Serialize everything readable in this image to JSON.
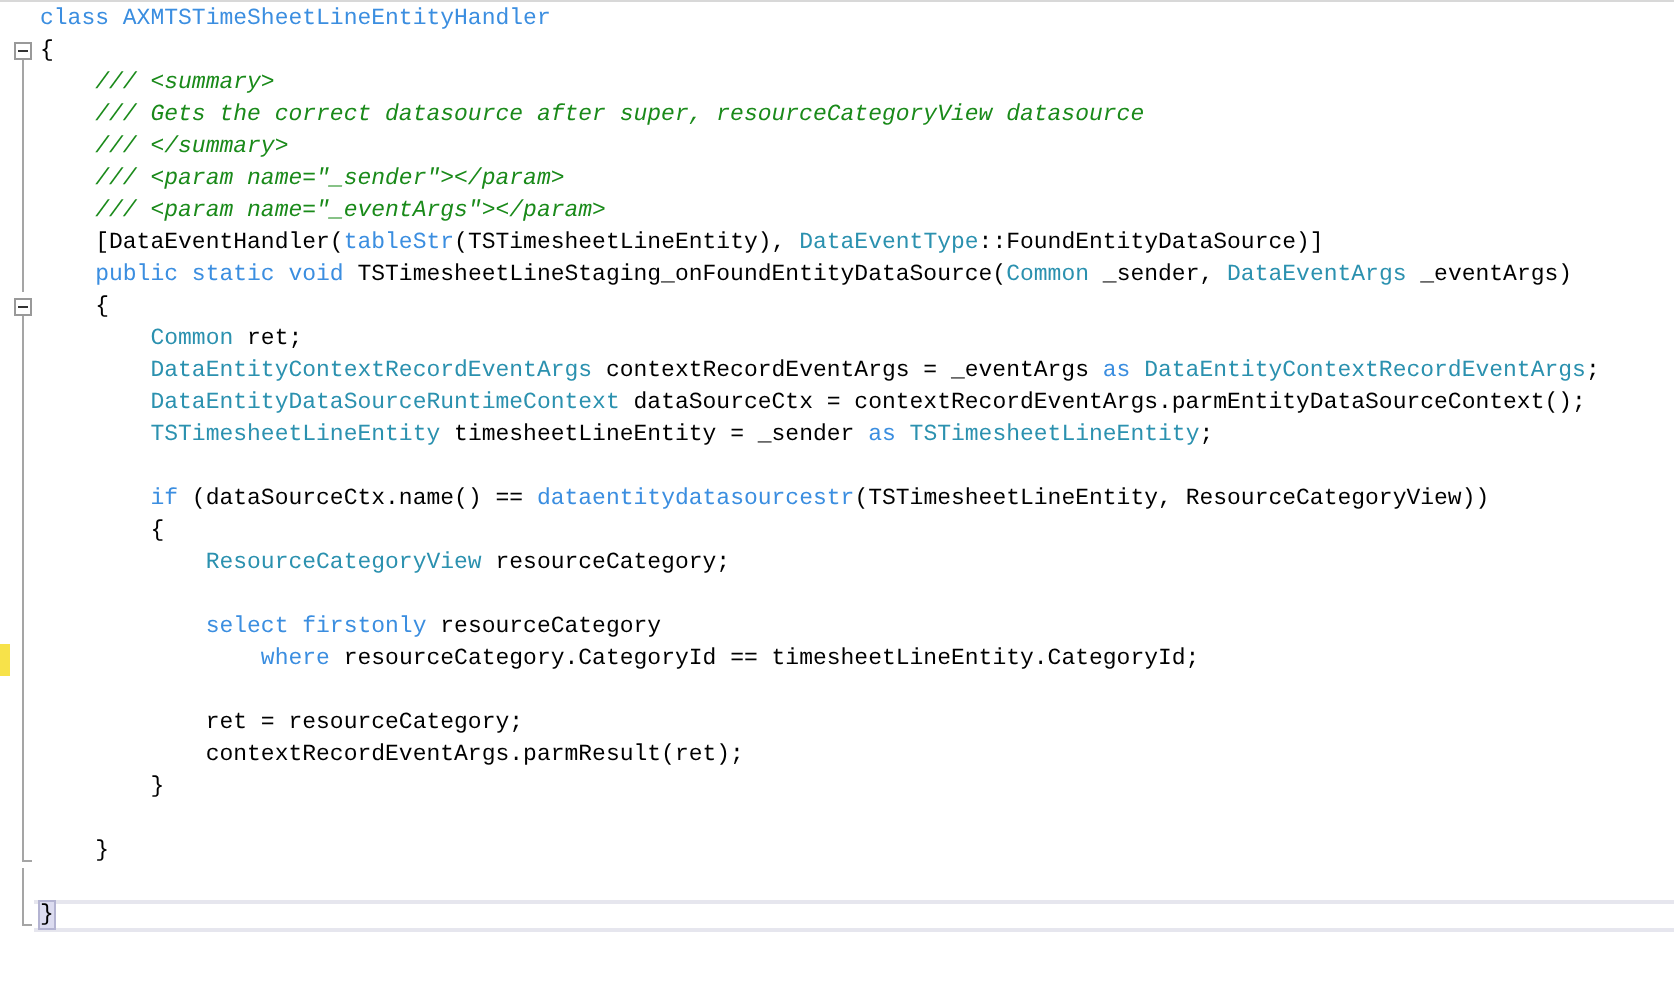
{
  "lines": [
    {
      "kind": "plain",
      "tokens": [
        {
          "kind": "keyword",
          "text": "class AXMTSTimeSheetLineEntityHandler"
        }
      ]
    },
    {
      "kind": "fold_start",
      "tokens": [
        {
          "kind": "plain",
          "text": "{"
        }
      ]
    },
    {
      "kind": "fold_body",
      "tokens": [
        {
          "kind": "comment",
          "text": "    /// <summary>"
        }
      ]
    },
    {
      "kind": "fold_body",
      "tokens": [
        {
          "kind": "comment",
          "text": "    /// Gets the correct datasource after super, resourceCategoryView datasource"
        }
      ]
    },
    {
      "kind": "fold_body",
      "tokens": [
        {
          "kind": "comment",
          "text": "    /// </summary>"
        }
      ]
    },
    {
      "kind": "fold_body",
      "tokens": [
        {
          "kind": "comment",
          "text": "    /// <param name=\"_sender\"></param>"
        }
      ]
    },
    {
      "kind": "fold_body",
      "tokens": [
        {
          "kind": "comment",
          "text": "    /// <param name=\"_eventArgs\"></param>"
        }
      ]
    },
    {
      "kind": "fold_body",
      "tokens": [
        {
          "kind": "plain",
          "text": "    [DataEventHandler("
        },
        {
          "kind": "keyword",
          "text": "tableStr"
        },
        {
          "kind": "plain",
          "text": "(TSTimesheetLineEntity), "
        },
        {
          "kind": "type",
          "text": "DataEventType"
        },
        {
          "kind": "plain",
          "text": "::FoundEntityDataSource)]"
        }
      ]
    },
    {
      "kind": "fold_body",
      "tokens": [
        {
          "kind": "keyword",
          "text": "    public static void"
        },
        {
          "kind": "plain",
          "text": " TSTimesheetLineStaging_onFoundEntityDataSource("
        },
        {
          "kind": "type",
          "text": "Common"
        },
        {
          "kind": "plain",
          "text": " _sender, "
        },
        {
          "kind": "type",
          "text": "DataEventArgs"
        },
        {
          "kind": "plain",
          "text": " _eventArgs)"
        }
      ]
    },
    {
      "kind": "fold_start",
      "tokens": [
        {
          "kind": "plain",
          "text": "    {"
        }
      ]
    },
    {
      "kind": "fold_body",
      "tokens": [
        {
          "kind": "type",
          "text": "        Common"
        },
        {
          "kind": "plain",
          "text": " ret;"
        }
      ]
    },
    {
      "kind": "fold_body",
      "tokens": [
        {
          "kind": "type",
          "text": "        DataEntityContextRecordEventArgs"
        },
        {
          "kind": "plain",
          "text": " contextRecordEventArgs = _eventArgs "
        },
        {
          "kind": "keyword",
          "text": "as"
        },
        {
          "kind": "type",
          "text": " DataEntityContextRecordEventArgs"
        },
        {
          "kind": "plain",
          "text": ";"
        }
      ]
    },
    {
      "kind": "fold_body",
      "tokens": [
        {
          "kind": "type",
          "text": "        DataEntityDataSourceRuntimeContext"
        },
        {
          "kind": "plain",
          "text": " dataSourceCtx = contextRecordEventArgs.parmEntityDataSourceContext();"
        }
      ]
    },
    {
      "kind": "fold_body",
      "tokens": [
        {
          "kind": "type",
          "text": "        TSTimesheetLineEntity"
        },
        {
          "kind": "plain",
          "text": " timesheetLineEntity = _sender "
        },
        {
          "kind": "keyword",
          "text": "as"
        },
        {
          "kind": "type",
          "text": " TSTimesheetLineEntity"
        },
        {
          "kind": "plain",
          "text": ";"
        }
      ]
    },
    {
      "kind": "fold_body"
    },
    {
      "kind": "fold_body",
      "tokens": [
        {
          "kind": "keyword",
          "text": "        if"
        },
        {
          "kind": "plain",
          "text": " (dataSourceCtx.name() == "
        },
        {
          "kind": "keyword",
          "text": "dataentitydatasourcestr"
        },
        {
          "kind": "plain",
          "text": "(TSTimesheetLineEntity, ResourceCategoryView))"
        }
      ]
    },
    {
      "kind": "fold_body",
      "tokens": [
        {
          "kind": "plain",
          "text": "        {"
        }
      ]
    },
    {
      "kind": "fold_body",
      "tokens": [
        {
          "kind": "type",
          "text": "            ResourceCategoryView"
        },
        {
          "kind": "plain",
          "text": " resourceCategory;"
        }
      ]
    },
    {
      "kind": "fold_body"
    },
    {
      "kind": "fold_body",
      "tokens": [
        {
          "kind": "keyword",
          "text": "            select firstonly"
        },
        {
          "kind": "plain",
          "text": " resourceCategory"
        }
      ]
    },
    {
      "kind": "fold_body",
      "changed": true,
      "tokens": [
        {
          "kind": "keyword",
          "text": "                where"
        },
        {
          "kind": "plain",
          "text": " resourceCategory.CategoryId == timesheetLineEntity.CategoryId;"
        }
      ]
    },
    {
      "kind": "fold_body"
    },
    {
      "kind": "fold_body",
      "tokens": [
        {
          "kind": "plain",
          "text": "            ret = resourceCategory;"
        }
      ]
    },
    {
      "kind": "fold_body",
      "tokens": [
        {
          "kind": "plain",
          "text": "            contextRecordEventArgs.parmResult(ret);"
        }
      ]
    },
    {
      "kind": "fold_body",
      "tokens": [
        {
          "kind": "plain",
          "text": "        }"
        }
      ]
    },
    {
      "kind": "fold_body"
    },
    {
      "kind": "fold_end",
      "tokens": [
        {
          "kind": "plain",
          "text": "    }"
        }
      ]
    },
    {
      "kind": "fold_body"
    },
    {
      "kind": "fold_end",
      "current": true,
      "tokens": [
        {
          "kind": "plain",
          "text": "}",
          "matched": true
        }
      ]
    }
  ]
}
